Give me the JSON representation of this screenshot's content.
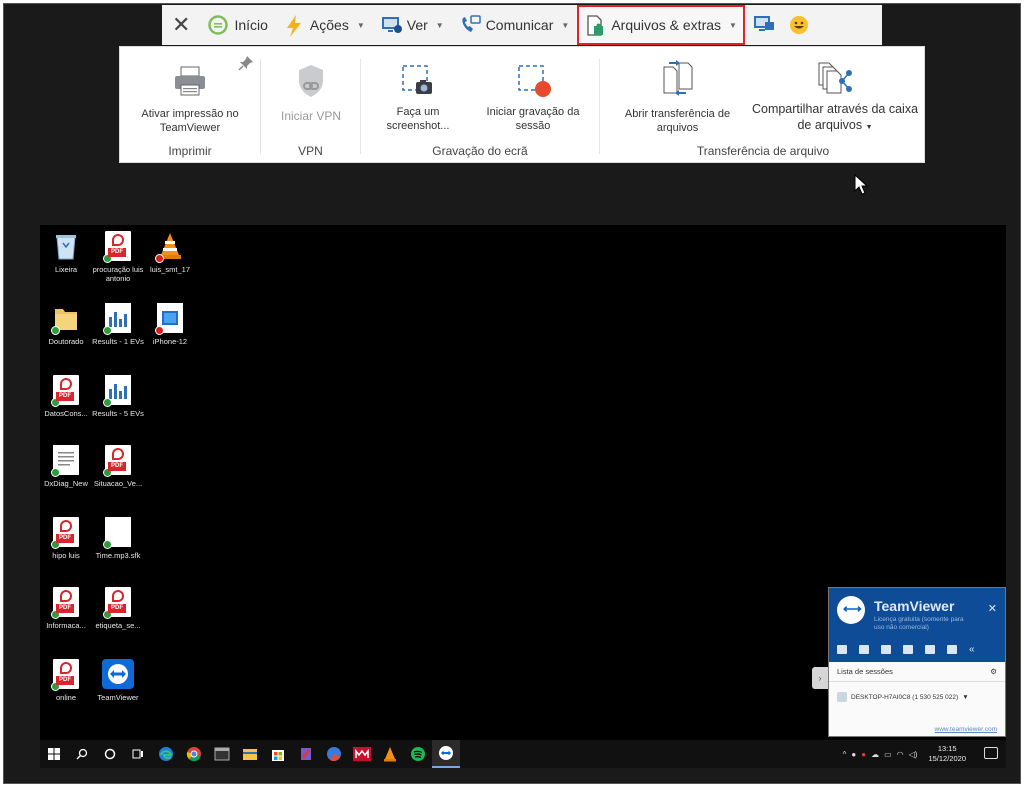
{
  "toolbar": {
    "close_label": "✕",
    "inicio": "Início",
    "acoes": "Ações",
    "ver": "Ver",
    "comunicar": "Comunicar",
    "arquivos": "Arquivos & extras",
    "highlight_color": "#e0232b"
  },
  "ribbon": {
    "imprimir": {
      "button": "Ativar impressão no TeamViewer",
      "title": "Imprimir"
    },
    "vpn": {
      "button": "Iniciar VPN",
      "title": "VPN"
    },
    "gravacao": {
      "screenshot": "Faça um screenshot...",
      "recording": "Iniciar gravação da sessão",
      "title": "Gravação do ecrã"
    },
    "transferencia": {
      "open": "Abrir transferência de arquivos",
      "share": "Compartilhar através da caixa de arquivos",
      "title": "Transferência de arquivo"
    }
  },
  "desktop": {
    "icons": [
      {
        "label": "Lixeira",
        "icon": "recycle-bin-icon"
      },
      {
        "label": "procuração luis antonio",
        "icon": "pdf-icon"
      },
      {
        "label": "luis_smt_17",
        "icon": "vlc-icon"
      },
      {
        "label": "Doutorado",
        "icon": "folder-icon"
      },
      {
        "label": "Results - 1 EVs",
        "icon": "chart-file-icon"
      },
      {
        "label": "iPhone-12",
        "icon": "image-file-icon"
      },
      {
        "label": "DatosCons...",
        "icon": "pdf-icon"
      },
      {
        "label": "Results - 5 EVs",
        "icon": "chart-file-icon"
      },
      {
        "label": "DxDiag_New",
        "icon": "text-file-icon"
      },
      {
        "label": "Situacao_Ve...",
        "icon": "pdf-icon"
      },
      {
        "label": "hipo luis",
        "icon": "pdf-icon"
      },
      {
        "label": "Time.mp3.sfk",
        "icon": "blank-file-icon"
      },
      {
        "label": "Informaca...",
        "icon": "pdf-icon"
      },
      {
        "label": "etiqueta_se...",
        "icon": "pdf-icon"
      },
      {
        "label": "online",
        "icon": "pdf-icon"
      },
      {
        "label": "TeamViewer",
        "icon": "teamviewer-icon"
      }
    ]
  },
  "taskbar": {
    "time": "13:15",
    "date": "15/12/2020"
  },
  "tvpanel": {
    "brand": "TeamViewer",
    "subtitle": "Licença gratuita (somente para uso não comercial)",
    "sessions_header": "Lista de sessões",
    "session_row": "DESKTOP-H7AI0C8 (1 530 525 022)",
    "footer_link": "www.teamviewer.com"
  }
}
